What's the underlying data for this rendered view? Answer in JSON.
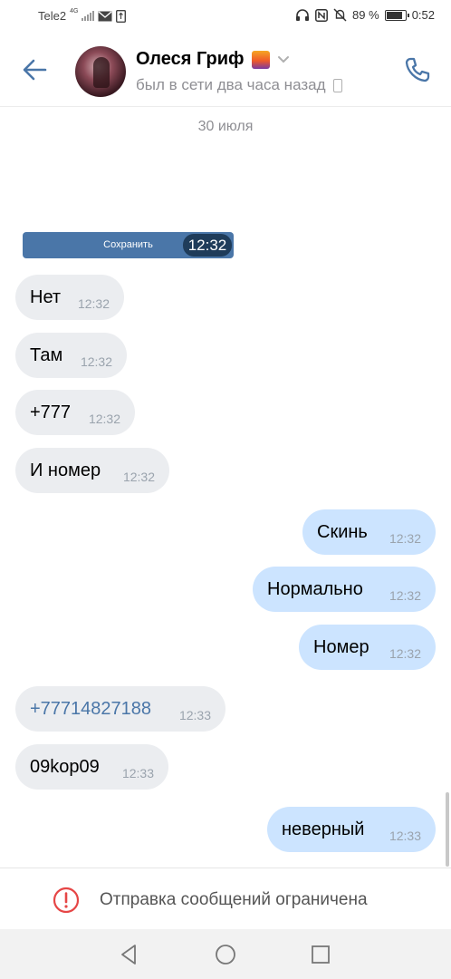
{
  "status_bar": {
    "carrier": "Tele2",
    "network": "4G",
    "battery_percent": "89 %",
    "battery_level": 0.89,
    "time": "0:52"
  },
  "header": {
    "name": "Олеся Гриф",
    "status": "был в сети два часа назад",
    "icons": [
      "arrow-left-icon",
      "avatar",
      "sunset-emoji-icon",
      "chevron-down-icon",
      "mobile-device-icon",
      "phone-icon"
    ],
    "accent_color": "#4a76a8"
  },
  "chat": {
    "date": "30 июля",
    "saved": {
      "label": "Сохранить",
      "time": "12:32"
    },
    "messages": [
      {
        "dir": "in",
        "text": "Нет",
        "time": "12:32"
      },
      {
        "dir": "in",
        "text": "Там",
        "time": "12:32"
      },
      {
        "dir": "in",
        "text": "+777",
        "time": "12:32"
      },
      {
        "dir": "in",
        "text": "И номер",
        "time": "12:32"
      },
      {
        "dir": "out",
        "text": "Скинь",
        "time": "12:32"
      },
      {
        "dir": "out",
        "text": "Нормально",
        "time": "12:32"
      },
      {
        "dir": "out",
        "text": "Номер",
        "time": "12:32"
      },
      {
        "dir": "in",
        "text": "+77714827188",
        "time": "12:33",
        "link": true
      },
      {
        "dir": "in",
        "text": "09kop09",
        "time": "12:33"
      },
      {
        "dir": "out",
        "text": "неверный",
        "time": "12:33"
      }
    ],
    "colors": {
      "incoming": "#ebedf0",
      "outgoing": "#cce4ff",
      "link": "#4a76a8"
    }
  },
  "restriction": {
    "text": "Отправка сообщений ограничена",
    "icon": "warning-circle-icon",
    "color": "#e64646"
  },
  "navbar": {
    "icons": [
      "back-triangle-icon",
      "home-circle-icon",
      "recents-square-icon"
    ]
  }
}
